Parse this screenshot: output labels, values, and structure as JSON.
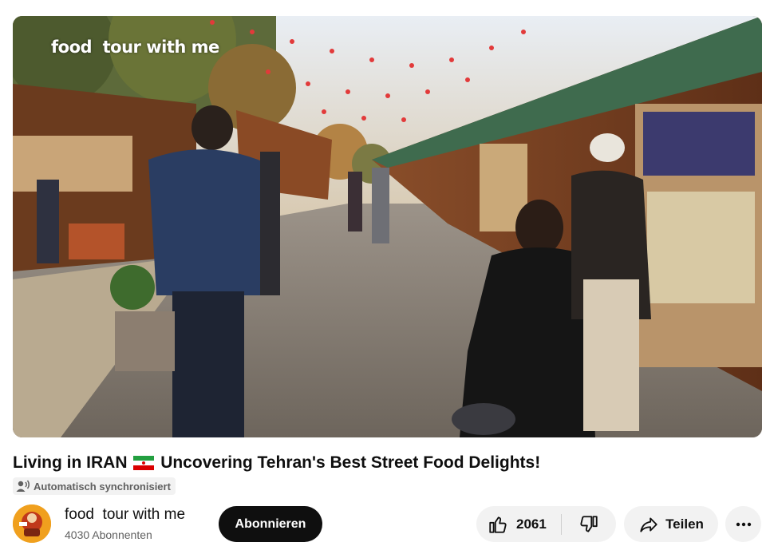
{
  "video": {
    "watermark": "food  tour with me",
    "title_before_flag": "Living in IRAN",
    "title_after_flag": "Uncovering Tehran's Best Street Food Delights!",
    "flag_icon": "iran-flag-icon",
    "sync_badge": "Automatisch synchronisiert"
  },
  "channel": {
    "name": "food  tour with me",
    "subscribers": "4030 Abonnenten",
    "subscribe_label": "Abonnieren"
  },
  "actions": {
    "like_count": "2061",
    "share_label": "Teilen",
    "icons": [
      "thumbs-up-icon",
      "thumbs-down-icon",
      "share-arrow-icon",
      "more-options-icon"
    ]
  },
  "colors": {
    "primary_text": "#0f0f0f",
    "secondary_text": "#606060",
    "button_bg": "#f2f2f2",
    "subscribe_bg": "#0f0f0f"
  }
}
